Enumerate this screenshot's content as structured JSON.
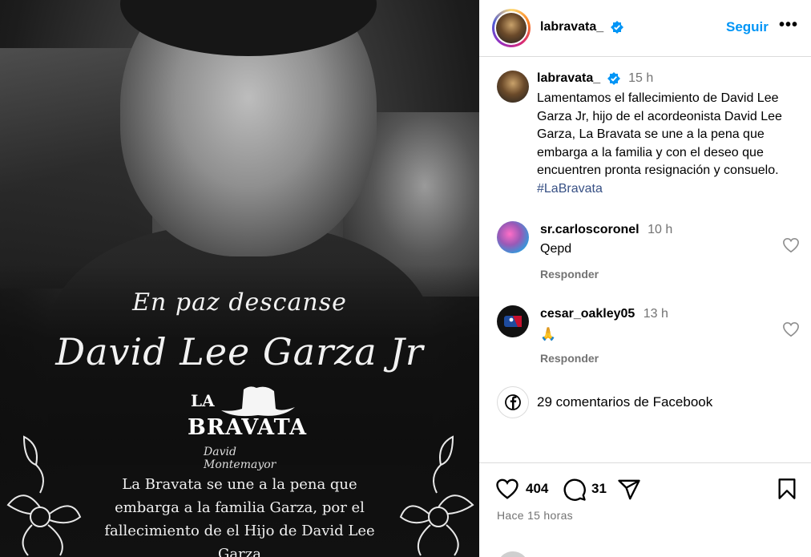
{
  "post_image": {
    "rip_subtitle": "En paz descanse",
    "rip_name": "David Lee Garza Jr",
    "logo_la": "LA",
    "logo_bravata": "BRAVATA",
    "logo_signature": "David Montemayor",
    "message": "La Bravata se une a la pena que embarga a la familia Garza, por el fallecimiento de el Hijo de David Lee Garza"
  },
  "header": {
    "username": "labravata_",
    "follow_label": "Seguir",
    "more_label": "•••"
  },
  "caption": {
    "username": "labravata_",
    "time": "15 h",
    "text": "Lamentamos el fallecimiento de David Lee Garza Jr, hijo de el acordeonista David Lee Garza, La Bravata se une a la pena que embarga a la familia y con el deseo que encuentren pronta resignación y consuelo.",
    "hashtag": "#LaBravata"
  },
  "comments": [
    {
      "username": "sr.carloscoronel",
      "time": "10 h",
      "text": "Qepd",
      "reply_label": "Responder"
    },
    {
      "username": "cesar_oakley05",
      "time": "13 h",
      "text": "🙏",
      "reply_label": "Responder"
    }
  ],
  "facebook": {
    "label": "29 comentarios de Facebook"
  },
  "actions": {
    "likes": "404",
    "comments": "31",
    "posted_ago": "Hace 15 horas"
  },
  "colors": {
    "link": "#0095f6",
    "verified": "#0095f6",
    "muted": "#737373"
  }
}
